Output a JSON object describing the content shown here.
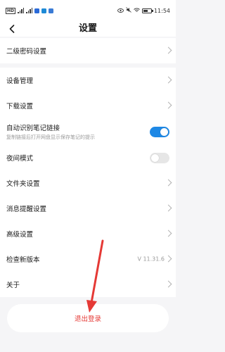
{
  "status_bar": {
    "left_icons": [
      "HD",
      "4G",
      "signal",
      "signal",
      "notif",
      "vpn",
      "app"
    ],
    "time": "11:54",
    "battery_level": 0.65,
    "badge_colors": [
      "#2a6ad8",
      "#1e8ad6",
      "#3a7bd5"
    ]
  },
  "header": {
    "back_icon": "chevron-left-icon",
    "title": "设置"
  },
  "groups": {
    "g1": {
      "items": [
        {
          "label": "二级密码设置"
        }
      ]
    },
    "g2": {
      "items": [
        {
          "label": "设备管理"
        },
        {
          "label": "下载设置"
        },
        {
          "label": "自动识别笔记链接",
          "subtitle": "复制链接后打开网盘显示保存笔记的提示",
          "toggle_on": true
        },
        {
          "label": "夜间模式",
          "toggle_on": false
        },
        {
          "label": "文件夹设置"
        },
        {
          "label": "消息提醒设置"
        },
        {
          "label": "高级设置"
        },
        {
          "label": "检查新版本",
          "value": "V 11.31.6"
        },
        {
          "label": "关于"
        }
      ]
    }
  },
  "logout": {
    "label": "退出登录"
  },
  "colors": {
    "accent_blue": "#1e88e5",
    "danger_red": "#e53935",
    "toggle_off": "#e6e6e6"
  }
}
